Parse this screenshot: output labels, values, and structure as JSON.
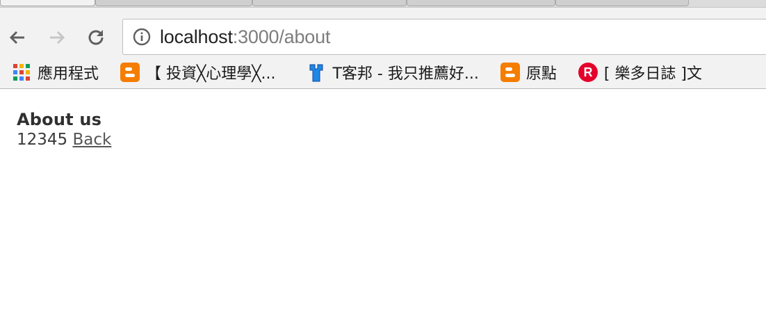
{
  "browser": {
    "url_host": "localhost",
    "url_rest": ":3000/about",
    "bookmarks": [
      {
        "icon": "apps-grid-icon",
        "label": "應用程式"
      },
      {
        "icon": "blogger-icon",
        "label": "【 投資╳心理學╳..."
      },
      {
        "icon": "wrench-icon",
        "label": "T客邦 - 我只推薦好..."
      },
      {
        "icon": "blogger-icon",
        "label": "原點"
      },
      {
        "icon": "rakuten-icon",
        "label": "[ 樂多日誌 ]文"
      }
    ],
    "colors": {
      "blogger": "#f57d00",
      "rakuten": "#e4002b",
      "wrench": "#1e88e5"
    }
  },
  "page": {
    "title": "About us",
    "number": "12345",
    "back_label": "Back"
  }
}
